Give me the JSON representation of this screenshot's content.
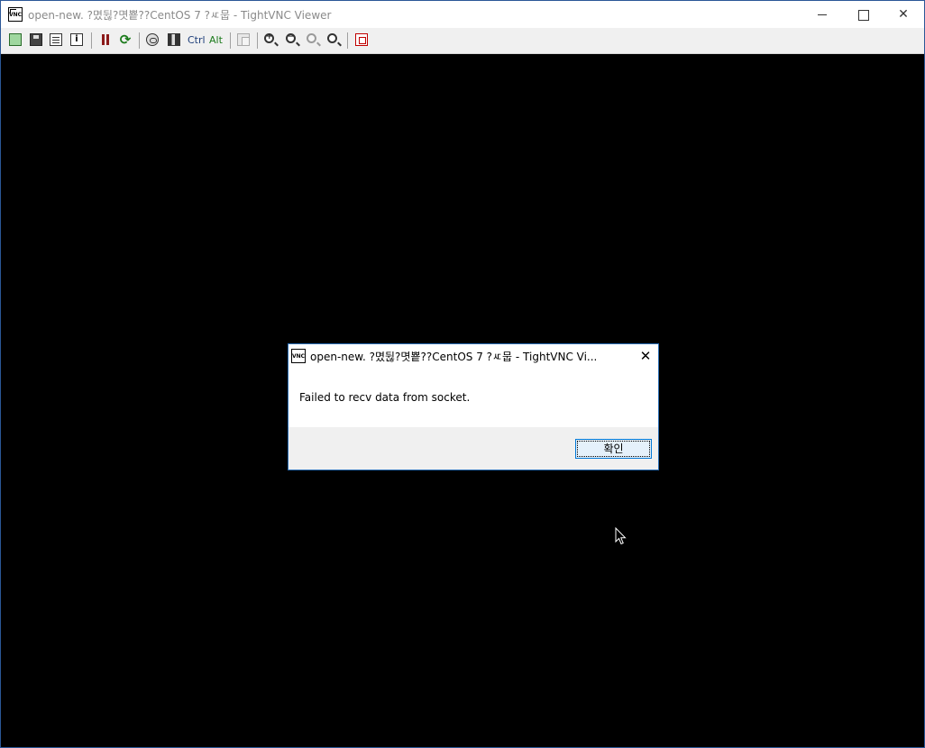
{
  "window": {
    "title": "open-new.        ?몄뒪?몃뿉??CentOS 7 ?ㅼ뭅 - TightVNC Viewer",
    "minimize_label": "",
    "maximize_label": "",
    "close_label": "✕"
  },
  "toolbar": {
    "items": [
      {
        "name": "new-connection-icon"
      },
      {
        "name": "save-session-icon"
      },
      {
        "name": "connection-options-icon"
      },
      {
        "name": "connection-info-icon"
      },
      {
        "name": "pause-icon"
      },
      {
        "name": "refresh-icon"
      },
      {
        "name": "ctrl-alt-del-icon"
      },
      {
        "name": "win-key-icon"
      },
      {
        "name": "ctrl-toggle",
        "label": "Ctrl"
      },
      {
        "name": "alt-toggle",
        "label": "Alt"
      },
      {
        "name": "transfer-files-icon"
      },
      {
        "name": "zoom-in-icon"
      },
      {
        "name": "zoom-out-icon"
      },
      {
        "name": "zoom-100-icon"
      },
      {
        "name": "zoom-auto-icon"
      },
      {
        "name": "fullscreen-icon"
      }
    ],
    "ctrl_label": "Ctrl",
    "alt_label": "Alt"
  },
  "dialog": {
    "title": "open-new.           ?몄뒪?몃뿉??CentOS 7 ?ㅼ뭅 - TightVNC Vi...",
    "message": "Failed to recv data from socket.",
    "ok_label": "확인",
    "close_label": "✕"
  },
  "colors": {
    "remote_screen": "#000000",
    "toolbar_bg": "#f0f0f0",
    "dialog_footer_bg": "#f0f0f0",
    "accent_border": "#0078d7"
  }
}
